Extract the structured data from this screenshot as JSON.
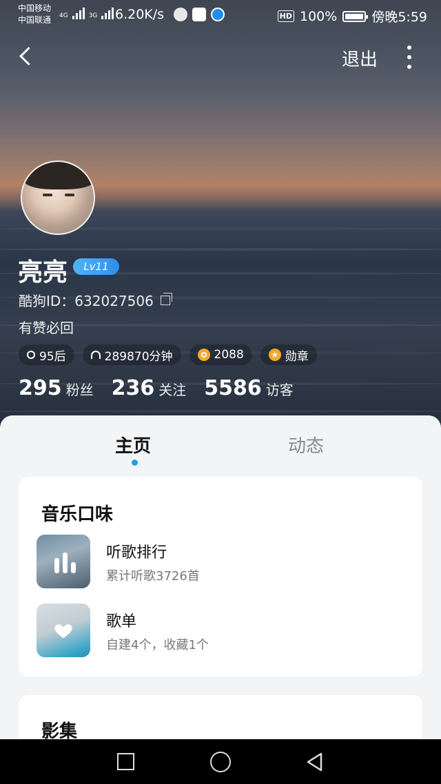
{
  "status_bar": {
    "carrier_1": "中国移动",
    "carrier_2": "中国联通",
    "network_1": "4G",
    "network_2": "3G",
    "speed": "6.20K/s",
    "hd": "HD",
    "battery": "100%",
    "time": "傍晚5:59"
  },
  "top_nav": {
    "exit_label": "退出"
  },
  "profile": {
    "name": "亮亮",
    "level": "Lv11",
    "kugou_id": "酷狗ID：632027506",
    "bio": "有赞必回",
    "chips": {
      "age": "95后",
      "listen_time": "289870分钟",
      "coins": "2088",
      "medal": "勋章"
    },
    "stats": {
      "fans_count": "295",
      "fans_label": "粉丝",
      "following_count": "236",
      "following_label": "关注",
      "visitors_count": "5586",
      "visitors_label": "访客"
    }
  },
  "tabs": {
    "home": "主页",
    "feed": "动态"
  },
  "music_taste": {
    "title": "音乐口味",
    "items": [
      {
        "title": "听歌排行",
        "subtitle": "累计听歌3726首"
      },
      {
        "title": "歌单",
        "subtitle": "自建4个，收藏1个"
      }
    ]
  },
  "video": {
    "title": "影集"
  },
  "colors": {
    "accent": "#1e9ef0",
    "coin": "#f4a92b"
  }
}
